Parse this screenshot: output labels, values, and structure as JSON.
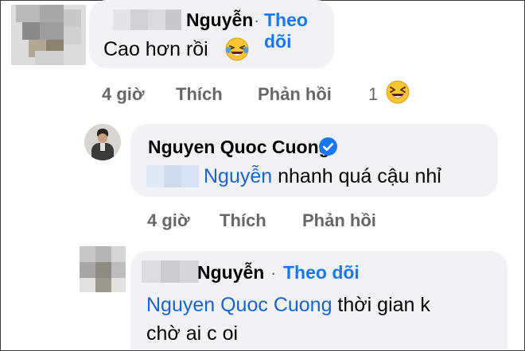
{
  "comment1": {
    "author": "Nguyễn",
    "separator": "·",
    "follow": "Theo dõi",
    "text": "Cao hơn rồi",
    "text_emoji": "laughing-tears-emoji",
    "time": "4 giờ",
    "like": "Thích",
    "reply": "Phản hồi",
    "reaction_count": "1",
    "reaction_emoji": "laughing-squint-emoji"
  },
  "comment2": {
    "author": "Nguyen Quoc Cuong",
    "verified_icon": "verified-badge-icon",
    "mention": "Nguyễn",
    "text": " nhanh quá cậu nhỉ",
    "time": "4 giờ",
    "like": "Thích",
    "reply": "Phản hồi"
  },
  "comment3": {
    "author": "Nguyễn",
    "separator": "·",
    "follow": "Theo dõi",
    "mention": "Nguyen Quoc Cuong",
    "text_line1": " thời gian k",
    "text_line2": "chờ ai c oi"
  },
  "colors": {
    "bubble": "#f0f2f5",
    "link": "#1877f2",
    "meta": "#65676b"
  }
}
